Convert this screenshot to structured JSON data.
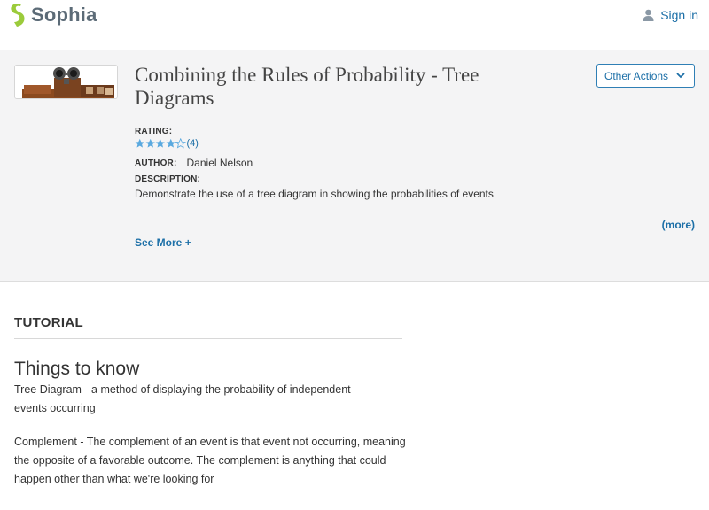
{
  "header": {
    "brand": "Sophia",
    "signin_label": "Sign in"
  },
  "resource": {
    "title_line1": "Combining the Rules of Probability - Tree",
    "title_line2": "Diagrams",
    "other_actions_label": "Other Actions",
    "rating_label": "RATING:",
    "rating_stars": 4,
    "rating_count": "(4)",
    "author_label": "AUTHOR:",
    "author_name": "Daniel Nelson",
    "description_label": "DESCRIPTION:",
    "description": "Demonstrate the use of a tree diagram in showing the probabilities of events",
    "more_link": "(more)",
    "see_more_link": "See More +"
  },
  "tutorial": {
    "section_label": "TUTORIAL",
    "heading": "Things to know",
    "paragraphs": {
      "p1_line1": "Tree Diagram - a method of displaying the probability of independent",
      "p1_line2": "events  occurring",
      "p2_line1": "Complement - The complement of an event is that event not occurring, meaning",
      "p2_line2": "the opposite of a favorable outcome. The complement is anything that could",
      "p2_line3": "happen other than what we're looking for"
    }
  },
  "colors": {
    "brand_green": "#9bcb3b",
    "link_blue": "#1c6fa7",
    "star_blue": "#5aa9df",
    "panel_bg": "#f4f4f5"
  },
  "icons": {
    "logo": "sophia-s-logo-icon",
    "signin": "user-icon",
    "dropdown": "chevron-down-icon",
    "star": "star-icon"
  }
}
